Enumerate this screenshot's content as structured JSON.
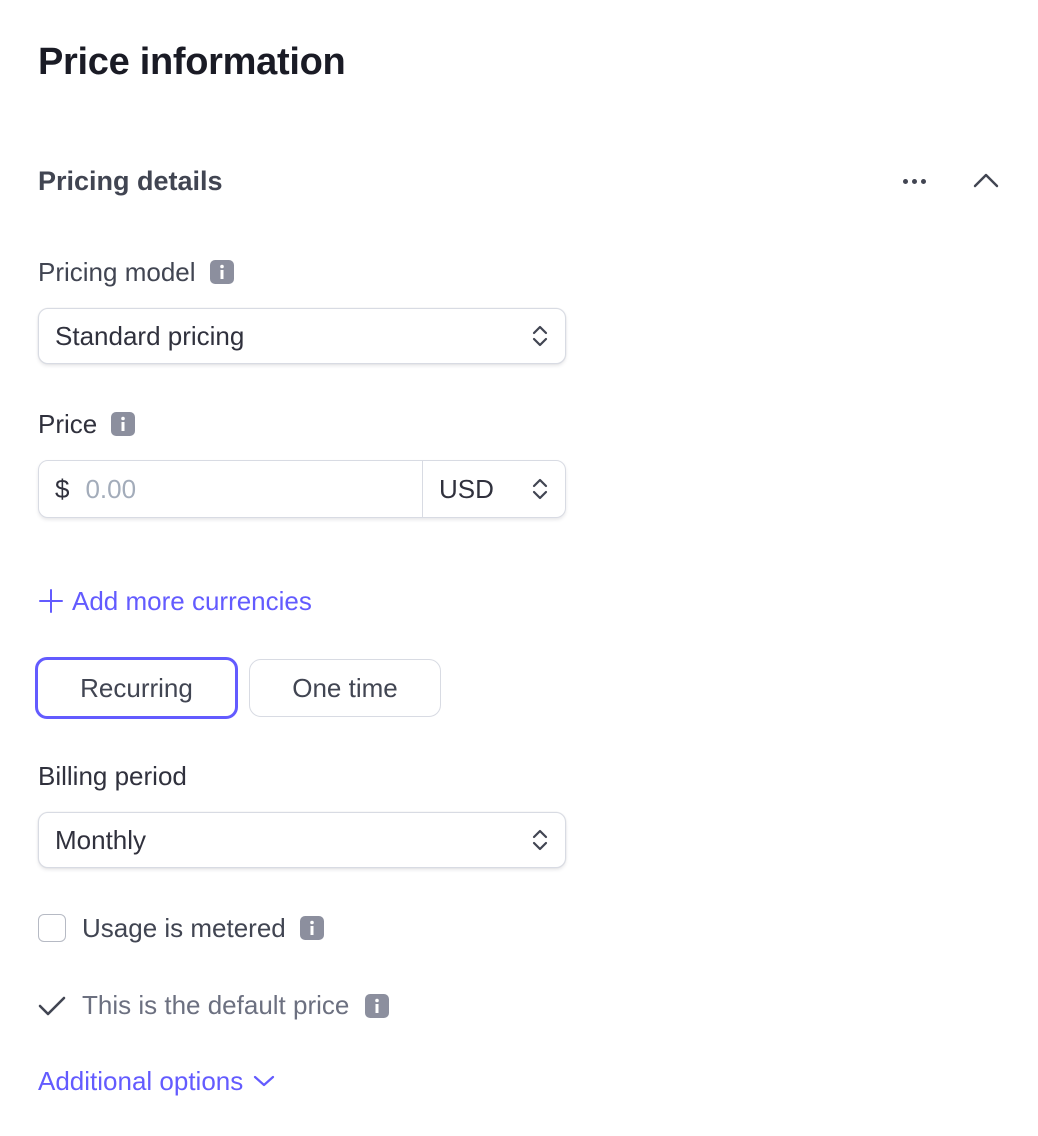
{
  "page": {
    "title": "Price information"
  },
  "section": {
    "title": "Pricing details"
  },
  "pricing_model": {
    "label": "Pricing model",
    "value": "Standard pricing"
  },
  "price": {
    "label": "Price",
    "currency_symbol": "$",
    "placeholder": "0.00",
    "currency": "USD"
  },
  "add_currencies": {
    "label": "Add more currencies"
  },
  "price_type": {
    "options": [
      "Recurring",
      "One time"
    ],
    "selected": "Recurring"
  },
  "billing_period": {
    "label": "Billing period",
    "value": "Monthly"
  },
  "metered": {
    "label": "Usage is metered",
    "checked": false
  },
  "default_price": {
    "label": "This is the default price",
    "checked": true
  },
  "additional_options": {
    "label": "Additional options"
  },
  "colors": {
    "accent": "#635bff",
    "text": "#30313d",
    "muted": "#6c7080",
    "border": "#d8dbe3"
  },
  "icons": [
    "more-icon",
    "chevron-up-icon",
    "info-icon",
    "select-arrows-icon",
    "plus-icon",
    "check-icon",
    "chevron-down-icon"
  ]
}
